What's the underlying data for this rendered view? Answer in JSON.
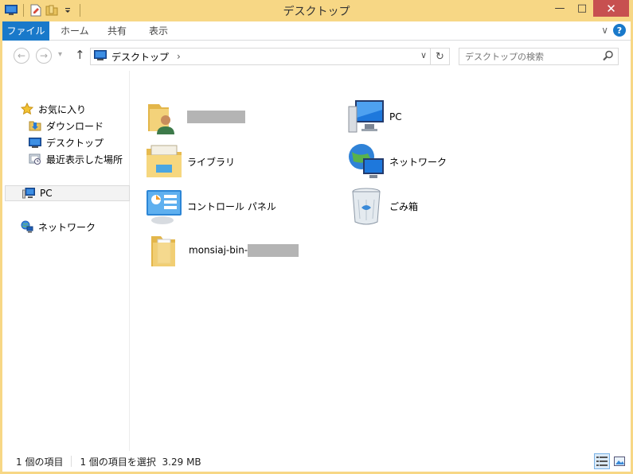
{
  "window": {
    "title": "デスクトップ",
    "minimize_glyph": "—",
    "maximize_glyph": "□",
    "close_glyph": "✕"
  },
  "ribbon": {
    "tabs": [
      "ファイル",
      "ホーム",
      "共有",
      "表示"
    ],
    "expand_glyph": "∨",
    "help_glyph": "?"
  },
  "address": {
    "back_glyph": "←",
    "forward_glyph": "→",
    "recent_glyph": "▾",
    "up_glyph": "↑",
    "path_label": "デスクトップ",
    "path_chevron": "›",
    "dropdown_glyph": "∨",
    "refresh_glyph": "↻"
  },
  "search": {
    "placeholder": "デスクトップの検索"
  },
  "nav": {
    "favorites": "お気に入り",
    "downloads": "ダウンロード",
    "desktop": "デスクトップ",
    "recent": "最近表示した場所",
    "pc": "PC",
    "network": "ネットワーク"
  },
  "items": {
    "user_folder": "",
    "pc": "PC",
    "libraries": "ライブラリ",
    "network": "ネットワーク",
    "control_panel": "コントロール パネル",
    "recycle_bin": "ごみ箱",
    "folder_prefix": "monsiaj-bin-"
  },
  "status": {
    "count": "1 個の項目",
    "selection": "1 個の項目を選択  3.29 MB"
  },
  "colors": {
    "frame": "#f7d785",
    "file_tab": "#1979ca",
    "close_button": "#c75050"
  }
}
